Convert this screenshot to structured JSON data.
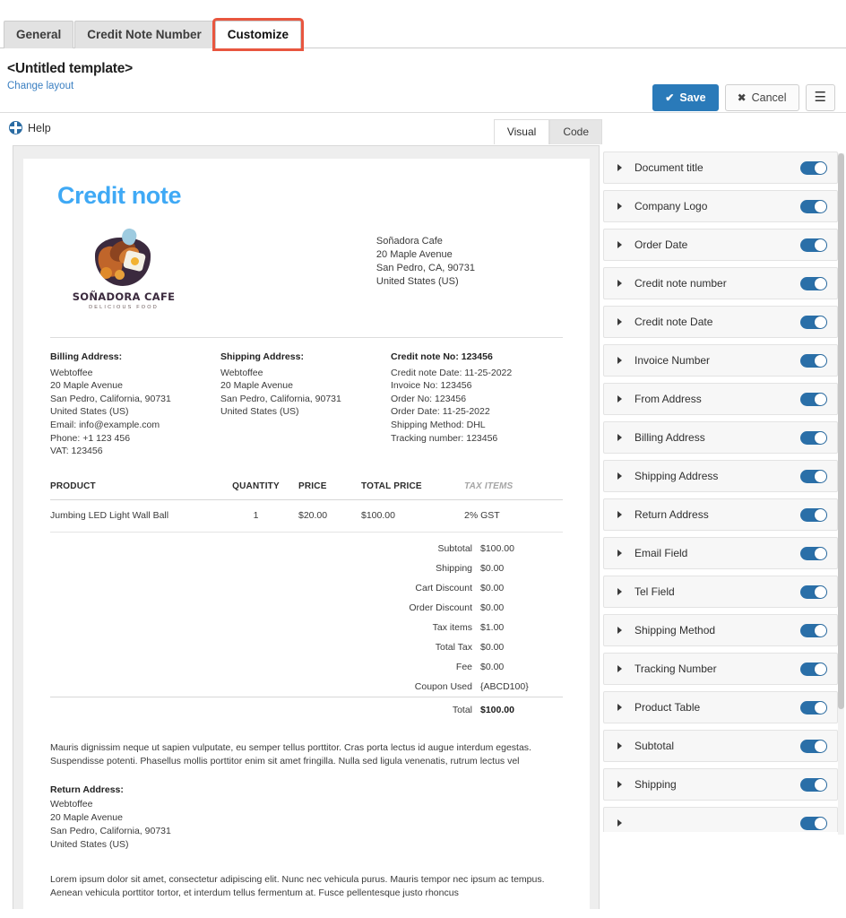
{
  "tabs": [
    {
      "label": "General",
      "active": false
    },
    {
      "label": "Credit Note Number",
      "active": false
    },
    {
      "label": "Customize",
      "active": true
    }
  ],
  "titlebar": {
    "title": "<Untitled template>",
    "change_layout": "Change layout",
    "save_label": "Save",
    "cancel_label": "Cancel",
    "save_icon": "check-icon",
    "cancel_icon": "close-icon",
    "menu_icon": "hamburger-icon",
    "accent_color": "#2a7ab9"
  },
  "subbar": {
    "help_label": "Help",
    "help_icon": "help-wheel-icon",
    "editor_tabs": [
      {
        "label": "Visual",
        "active": true
      },
      {
        "label": "Code",
        "active": false
      }
    ]
  },
  "document": {
    "heading": "Credit note",
    "heading_color": "#3fa9f5",
    "logo": {
      "name": "SOÑADORA CAFE",
      "tagline": "DELICIOUS FOOD",
      "icon": "cafe-bowl-logo-icon"
    },
    "from_address": [
      "Soñadora Cafe",
      "20 Maple Avenue",
      "San Pedro, CA, 90731",
      "United States (US)"
    ],
    "billing": {
      "heading": "Billing Address:",
      "lines": [
        "Webtoffee",
        "20 Maple Avenue",
        "San Pedro, California, 90731",
        "United States (US)",
        "Email: info@example.com",
        "Phone: +1 123 456",
        "VAT: 123456"
      ]
    },
    "shipping": {
      "heading": "Shipping Address:",
      "lines": [
        "Webtoffee",
        "20 Maple Avenue",
        "San Pedro, California, 90731",
        "United States (US)"
      ]
    },
    "meta": {
      "credit_note_no_label": "Credit note No:",
      "credit_note_no": "123456",
      "lines": [
        "Credit note Date: 11-25-2022",
        "Invoice No: 123456",
        "Order No: 123456",
        "Order Date: 11-25-2022",
        "Shipping Method: DHL",
        "Tracking number: 123456"
      ]
    },
    "product_table": {
      "columns": [
        "PRODUCT",
        "QUANTITY",
        "PRICE",
        "TOTAL PRICE",
        "TAX ITEMS"
      ],
      "rows": [
        {
          "product": "Jumbing LED Light Wall Ball",
          "quantity": "1",
          "price": "$20.00",
          "total_price": "$100.00",
          "tax_items": "2% GST"
        }
      ]
    },
    "totals": [
      {
        "label": "Subtotal",
        "value": "$100.00"
      },
      {
        "label": "Shipping",
        "value": "$0.00"
      },
      {
        "label": "Cart Discount",
        "value": "$0.00"
      },
      {
        "label": "Order Discount",
        "value": "$0.00"
      },
      {
        "label": "Tax items",
        "value": "$1.00"
      },
      {
        "label": "Total Tax",
        "value": "$0.00"
      },
      {
        "label": "Fee",
        "value": "$0.00"
      },
      {
        "label": "Coupon Used",
        "value": "{ABCD100}"
      }
    ],
    "grand_total": {
      "label": "Total",
      "value": "$100.00"
    },
    "note_paragraph": "Mauris dignissim neque ut sapien vulputate, eu semper tellus porttitor. Cras porta lectus id augue interdum egestas. Suspendisse potenti. Phasellus mollis porttitor enim sit amet fringilla. Nulla sed ligula venenatis, rutrum lectus vel",
    "return_address": {
      "heading": "Return Address:",
      "lines": [
        "Webtoffee",
        "20 Maple Avenue",
        "San Pedro, California, 90731",
        "United States (US)"
      ]
    },
    "footer_paragraph": "Lorem ipsum dolor sit amet, consectetur adipiscing elit. Nunc nec vehicula purus. Mauris tempor nec ipsum ac tempus. Aenean vehicula porttitor tortor, et interdum tellus fermentum at. Fusce pellentesque justo rhoncus"
  },
  "panel": {
    "toggle_on_color": "#2a6fa8",
    "items": [
      {
        "label": "Document title",
        "enabled": true
      },
      {
        "label": "Company Logo",
        "enabled": true
      },
      {
        "label": "Order Date",
        "enabled": true
      },
      {
        "label": "Credit note number",
        "enabled": true
      },
      {
        "label": "Credit note Date",
        "enabled": true
      },
      {
        "label": "Invoice Number",
        "enabled": true
      },
      {
        "label": "From Address",
        "enabled": true
      },
      {
        "label": "Billing Address",
        "enabled": true
      },
      {
        "label": "Shipping Address",
        "enabled": true
      },
      {
        "label": "Return Address",
        "enabled": true
      },
      {
        "label": "Email Field",
        "enabled": true
      },
      {
        "label": "Tel Field",
        "enabled": true
      },
      {
        "label": "Shipping Method",
        "enabled": true
      },
      {
        "label": "Tracking Number",
        "enabled": true
      },
      {
        "label": "Product Table",
        "enabled": true
      },
      {
        "label": "Subtotal",
        "enabled": true
      },
      {
        "label": "Shipping",
        "enabled": true
      },
      {
        "label": "",
        "enabled": true
      }
    ]
  }
}
